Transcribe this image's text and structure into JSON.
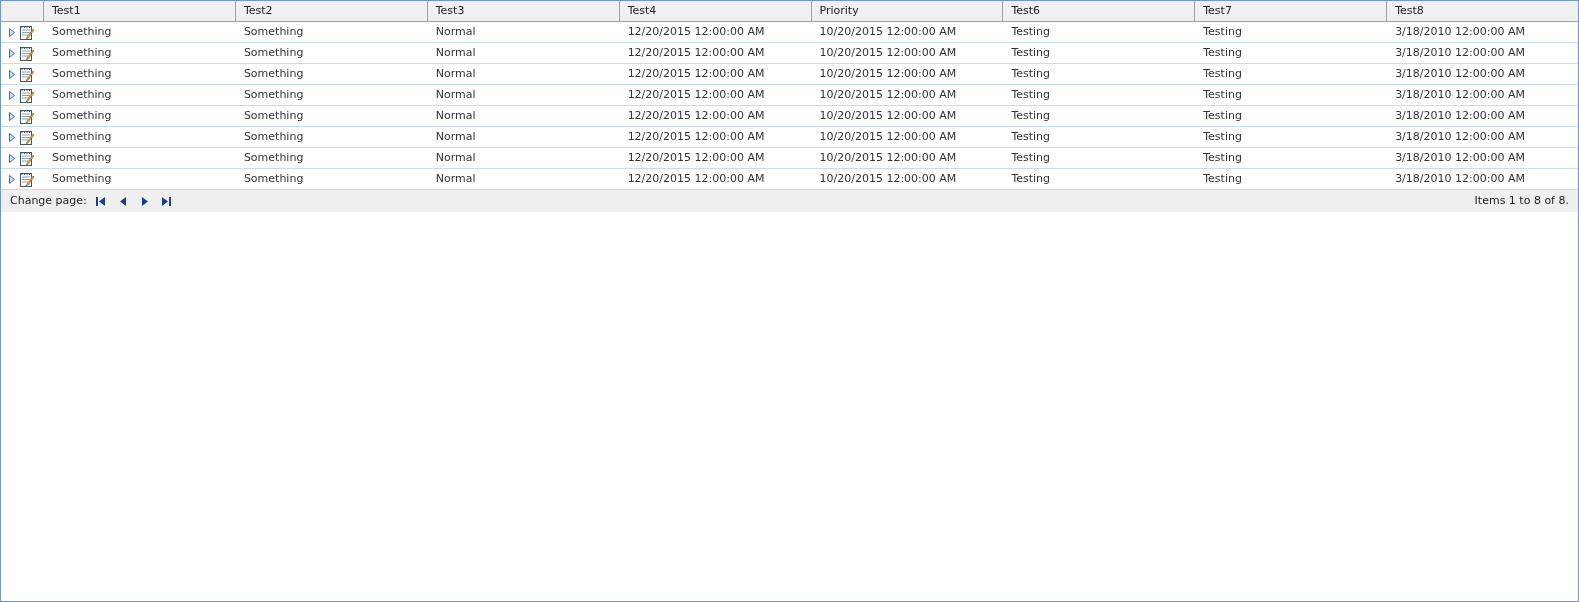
{
  "table": {
    "columns": [
      "Test1",
      "Test2",
      "Test3",
      "Test4",
      "Priority",
      "Test6",
      "Test7",
      "Test8"
    ],
    "rows": [
      {
        "expanded": false,
        "cells": [
          "Something",
          "Something",
          "Normal",
          "12/20/2015 12:00:00 AM",
          "10/20/2015 12:00:00 AM",
          "Testing",
          "Testing",
          "3/18/2010 12:00:00 AM"
        ]
      },
      {
        "expanded": false,
        "cells": [
          "Something",
          "Something",
          "Normal",
          "12/20/2015 12:00:00 AM",
          "10/20/2015 12:00:00 AM",
          "Testing",
          "Testing",
          "3/18/2010 12:00:00 AM"
        ]
      },
      {
        "expanded": false,
        "cells": [
          "Something",
          "Something",
          "Normal",
          "12/20/2015 12:00:00 AM",
          "10/20/2015 12:00:00 AM",
          "Testing",
          "Testing",
          "3/18/2010 12:00:00 AM"
        ]
      },
      {
        "expanded": false,
        "cells": [
          "Something",
          "Something",
          "Normal",
          "12/20/2015 12:00:00 AM",
          "10/20/2015 12:00:00 AM",
          "Testing",
          "Testing",
          "3/18/2010 12:00:00 AM"
        ]
      },
      {
        "expanded": false,
        "cells": [
          "Something",
          "Something",
          "Normal",
          "12/20/2015 12:00:00 AM",
          "10/20/2015 12:00:00 AM",
          "Testing",
          "Testing",
          "3/18/2010 12:00:00 AM"
        ]
      },
      {
        "expanded": false,
        "cells": [
          "Something",
          "Something",
          "Normal",
          "12/20/2015 12:00:00 AM",
          "10/20/2015 12:00:00 AM",
          "Testing",
          "Testing",
          "3/18/2010 12:00:00 AM"
        ]
      },
      {
        "expanded": false,
        "cells": [
          "Something",
          "Something",
          "Normal",
          "12/20/2015 12:00:00 AM",
          "10/20/2015 12:00:00 AM",
          "Testing",
          "Testing",
          "3/18/2010 12:00:00 AM"
        ]
      },
      {
        "expanded": false,
        "cells": [
          "Something",
          "Something",
          "Normal",
          "12/20/2015 12:00:00 AM",
          "10/20/2015 12:00:00 AM",
          "Testing",
          "Testing",
          "3/18/2010 12:00:00 AM"
        ]
      }
    ]
  },
  "pager": {
    "label": "Change page:",
    "summary": "Items 1 to 8 of 8."
  }
}
